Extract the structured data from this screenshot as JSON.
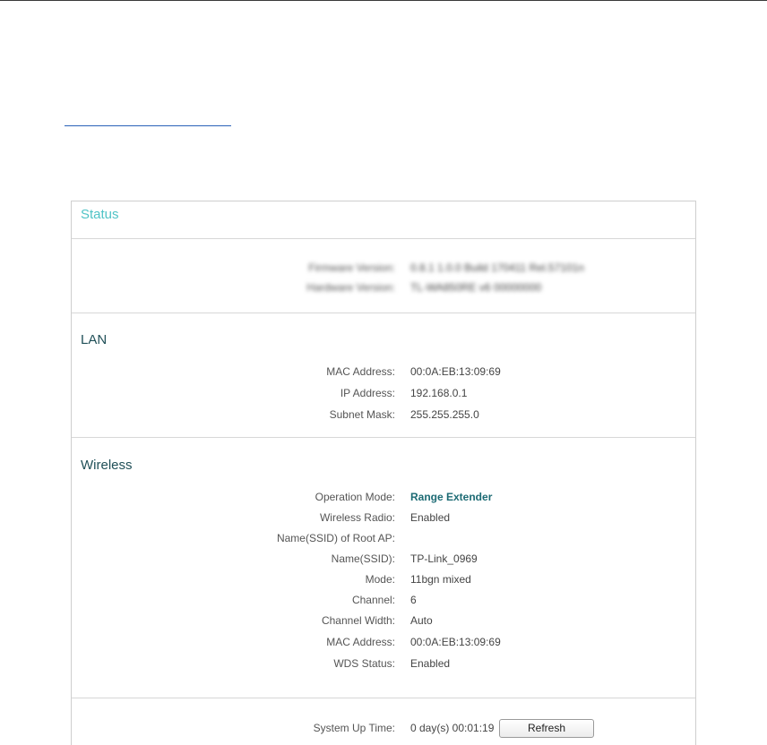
{
  "status": {
    "title": "Status",
    "firmware_label": "Firmware Version:",
    "firmware_value": "0.8.1 1.0.0 Build 170411 Rel.57101n",
    "hardware_label": "Hardware Version:",
    "hardware_value": "TL-WA850RE v6 00000000"
  },
  "lan": {
    "heading": "LAN",
    "rows": [
      {
        "label": "MAC Address:",
        "value": "00:0A:EB:13:09:69"
      },
      {
        "label": "IP Address:",
        "value": "192.168.0.1"
      },
      {
        "label": "Subnet Mask:",
        "value": "255.255.255.0"
      }
    ]
  },
  "wireless": {
    "heading": "Wireless",
    "rows": [
      {
        "label": "Operation Mode:",
        "value": "Range Extender"
      },
      {
        "label": "Wireless Radio:",
        "value": "Enabled"
      },
      {
        "label": "Name(SSID) of Root AP:",
        "value": ""
      },
      {
        "label": "Name(SSID):",
        "value": "TP-Link_0969"
      },
      {
        "label": "Mode:",
        "value": "11bgn mixed"
      },
      {
        "label": "Channel:",
        "value": "6"
      },
      {
        "label": "Channel Width:",
        "value": "Auto"
      },
      {
        "label": "MAC Address:",
        "value": "00:0A:EB:13:09:69"
      },
      {
        "label": "WDS Status:",
        "value": "Enabled"
      }
    ]
  },
  "system": {
    "uptime_label": "System Up Time:",
    "uptime_value": "0 day(s) 00:01:19",
    "refresh_label": "Refresh"
  },
  "colors": {
    "title_accent": "#4fc3c6",
    "section_heading": "#1f4f57",
    "highlight_value": "#1d6b74",
    "link_underline": "#2a62b8"
  }
}
